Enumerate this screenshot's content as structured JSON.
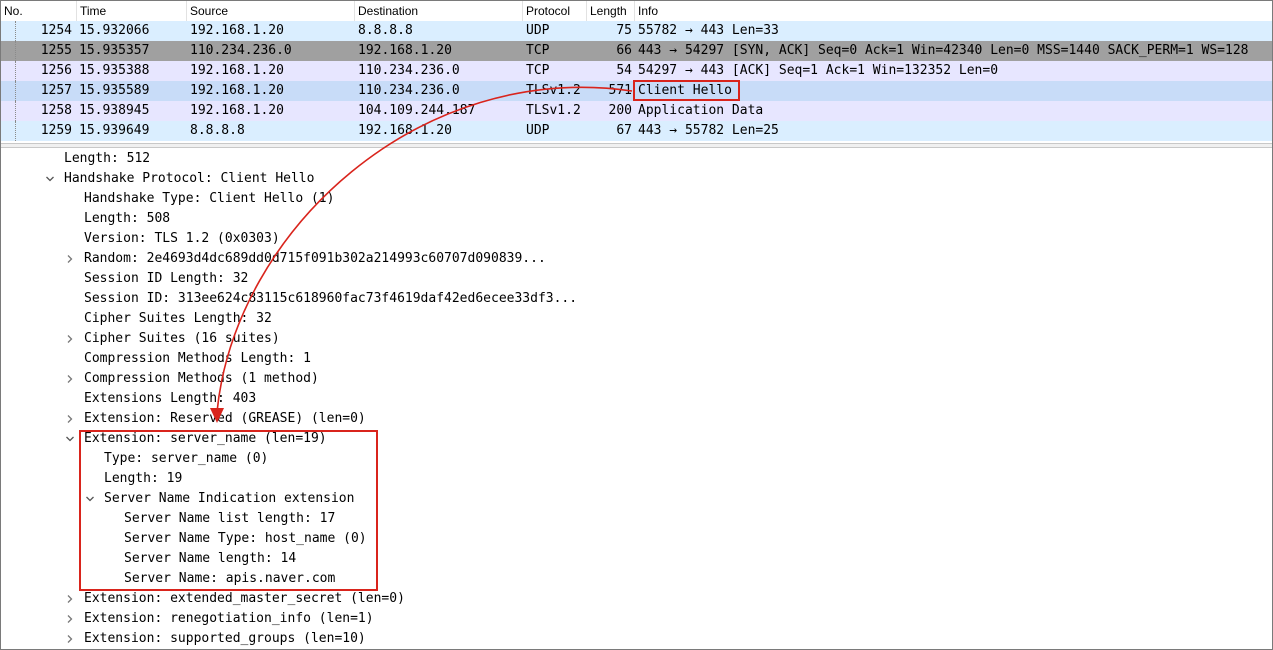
{
  "columns": {
    "no": "No.",
    "time": "Time",
    "source": "Source",
    "destination": "Destination",
    "protocol": "Protocol",
    "length": "Length",
    "info": "Info"
  },
  "packets": [
    {
      "no": "1254",
      "time": "15.932066",
      "source": "192.168.1.20",
      "destination": "8.8.8.8",
      "protocol": "UDP",
      "length": "75",
      "info": "55782 → 443 Len=33",
      "bg": "#daeeff"
    },
    {
      "no": "1255",
      "time": "15.935357",
      "source": "110.234.236.0",
      "destination": "192.168.1.20",
      "protocol": "TCP",
      "length": "66",
      "info": "443 → 54297 [SYN, ACK] Seq=0 Ack=1 Win=42340 Len=0 MSS=1440 SACK_PERM=1 WS=128",
      "bg": "#a0a0a0"
    },
    {
      "no": "1256",
      "time": "15.935388",
      "source": "192.168.1.20",
      "destination": "110.234.236.0",
      "protocol": "TCP",
      "length": "54",
      "info": "54297 → 443 [ACK] Seq=1 Ack=1 Win=132352 Len=0",
      "bg": "#e7e6ff"
    },
    {
      "no": "1257",
      "time": "15.935589",
      "source": "192.168.1.20",
      "destination": "110.234.236.0",
      "protocol": "TLSv1.2",
      "length": "571",
      "info": "Client Hello",
      "bg": "#c8dcf8"
    },
    {
      "no": "1258",
      "time": "15.938945",
      "source": "192.168.1.20",
      "destination": "104.109.244.187",
      "protocol": "TLSv1.2",
      "length": "200",
      "info": "Application Data",
      "bg": "#e7e6ff"
    },
    {
      "no": "1259",
      "time": "15.939649",
      "source": "8.8.8.8",
      "destination": "192.168.1.20",
      "protocol": "UDP",
      "length": "67",
      "info": "443 → 55782 Len=25",
      "bg": "#daeeff"
    }
  ],
  "details": [
    {
      "text": "Length: 512",
      "level": 0,
      "toggle": "none"
    },
    {
      "text": "Handshake Protocol: Client Hello",
      "level": 0,
      "toggle": "expanded"
    },
    {
      "text": "Handshake Type: Client Hello (1)",
      "level": 1,
      "toggle": "none"
    },
    {
      "text": "Length: 508",
      "level": 1,
      "toggle": "none"
    },
    {
      "text": "Version: TLS 1.2 (0x0303)",
      "level": 1,
      "toggle": "none"
    },
    {
      "text": "Random: 2e4693d4dc689dd0d715f091b302a214993c60707d090839...",
      "level": 1,
      "toggle": "collapsed"
    },
    {
      "text": "Session ID Length: 32",
      "level": 1,
      "toggle": "none"
    },
    {
      "text": "Session ID: 313ee624c83115c618960fac73f4619daf42ed6ecee33df3...",
      "level": 1,
      "toggle": "none"
    },
    {
      "text": "Cipher Suites Length: 32",
      "level": 1,
      "toggle": "none"
    },
    {
      "text": "Cipher Suites (16 suites)",
      "level": 1,
      "toggle": "collapsed"
    },
    {
      "text": "Compression Methods Length: 1",
      "level": 1,
      "toggle": "none"
    },
    {
      "text": "Compression Methods (1 method)",
      "level": 1,
      "toggle": "collapsed"
    },
    {
      "text": "Extensions Length: 403",
      "level": 1,
      "toggle": "none"
    },
    {
      "text": "Extension: Reserved (GREASE) (len=0)",
      "level": 1,
      "toggle": "collapsed"
    },
    {
      "text": "Extension: server_name (len=19)",
      "level": 1,
      "toggle": "expanded"
    },
    {
      "text": "Type: server_name (0)",
      "level": 2,
      "toggle": "none"
    },
    {
      "text": "Length: 19",
      "level": 2,
      "toggle": "none"
    },
    {
      "text": "Server Name Indication extension",
      "level": 2,
      "toggle": "expanded"
    },
    {
      "text": "Server Name list length: 17",
      "level": 3,
      "toggle": "none"
    },
    {
      "text": "Server Name Type: host_name (0)",
      "level": 3,
      "toggle": "none"
    },
    {
      "text": "Server Name length: 14",
      "level": 3,
      "toggle": "none"
    },
    {
      "text": "Server Name: apis.naver.com",
      "level": 3,
      "toggle": "none"
    },
    {
      "text": "Extension: extended_master_secret (len=0)",
      "level": 1,
      "toggle": "collapsed"
    },
    {
      "text": "Extension: renegotiation_info (len=1)",
      "level": 1,
      "toggle": "collapsed"
    },
    {
      "text": "Extension: supported_groups (len=10)",
      "level": 1,
      "toggle": "collapsed"
    }
  ],
  "colors": {
    "annotation": "#d9241c",
    "chevron": "#555555"
  }
}
